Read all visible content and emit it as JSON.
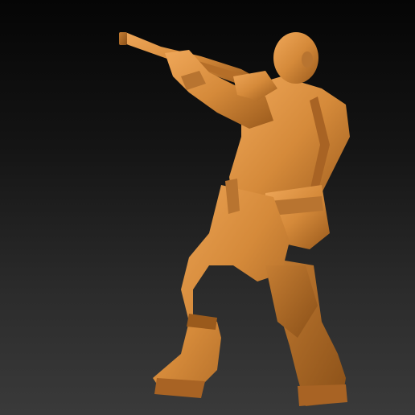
{
  "scene": {
    "subject": "sculpt-figure-rifleman",
    "background_top": "#050505",
    "background_bottom": "#3a3a3a",
    "clay_color": "#d58a3a",
    "clay_shadow": "#9a5a1c",
    "clay_highlight": "#f0a85a"
  }
}
